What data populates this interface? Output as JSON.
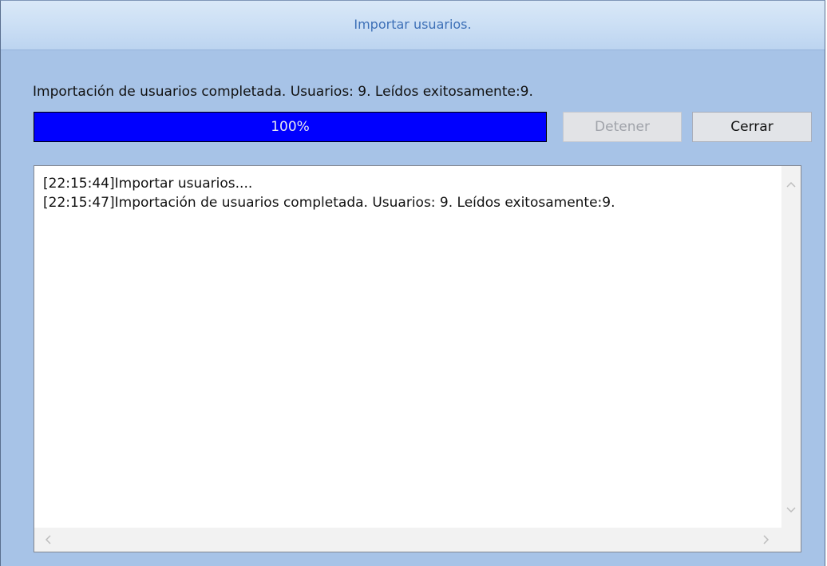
{
  "window": {
    "title": "Importar usuarios."
  },
  "status": {
    "message": "Importación de usuarios completada. Usuarios: 9. Leídos exitosamente:9."
  },
  "progress": {
    "value_percent": 100,
    "label": "100%",
    "fill_color": "#0000ff"
  },
  "buttons": {
    "stop_label": "Detener",
    "close_label": "Cerrar"
  },
  "log": {
    "lines": [
      "[22:15:44]Importar usuarios....",
      "[22:15:47]Importación de usuarios completada. Usuarios: 9. Leídos exitosamente:9."
    ]
  },
  "icons": {
    "scroll_up": "chevron-up-icon",
    "scroll_down": "chevron-down-icon",
    "scroll_left": "chevron-left-icon",
    "scroll_right": "chevron-right-icon"
  },
  "colors": {
    "dialog_background": "#a7c3e7",
    "title_text": "#3d70b7"
  }
}
